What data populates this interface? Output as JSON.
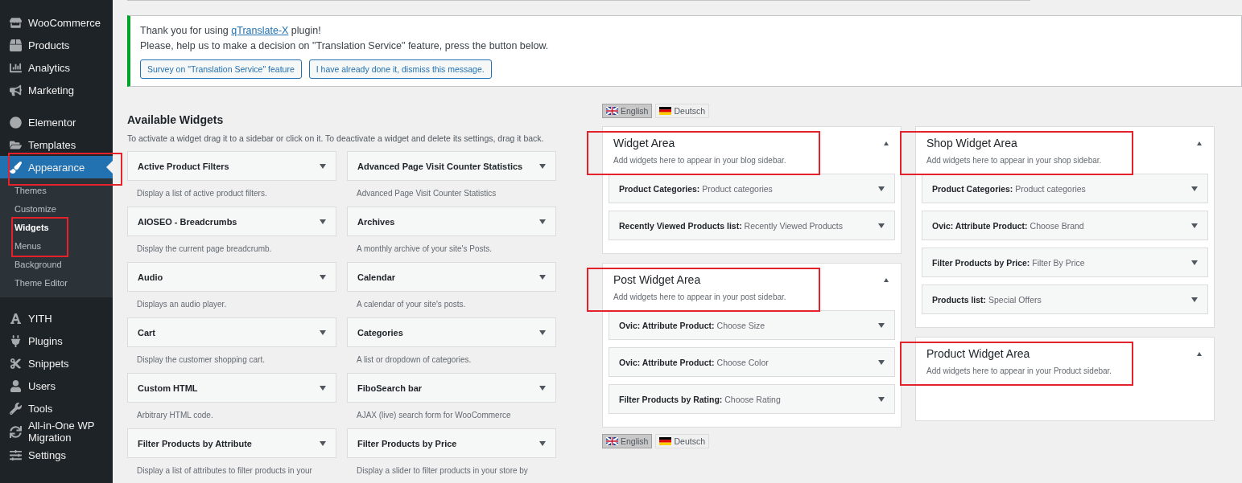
{
  "sidebar": {
    "sections": [
      {
        "items": [
          {
            "label": "WooCommerce",
            "selected": false,
            "annotated": false
          },
          {
            "label": "Products",
            "selected": false,
            "annotated": false
          },
          {
            "label": "Analytics",
            "selected": false,
            "annotated": false
          },
          {
            "label": "Marketing",
            "selected": false,
            "annotated": false
          }
        ]
      },
      {
        "items": [
          {
            "label": "Elementor",
            "selected": false,
            "annotated": false
          },
          {
            "label": "Templates",
            "selected": false,
            "annotated": false
          },
          {
            "label": "Appearance",
            "selected": true,
            "annotated": true,
            "children": [
              {
                "label": "Themes",
                "selected": false,
                "annotated": false
              },
              {
                "label": "Customize",
                "selected": false,
                "annotated": false
              },
              {
                "label": "Widgets",
                "selected": true,
                "annotated": true
              },
              {
                "label": "Menus",
                "selected": false,
                "annotated": false
              },
              {
                "label": "Background",
                "selected": false,
                "annotated": false
              },
              {
                "label": "Theme Editor",
                "selected": false,
                "annotated": false
              }
            ]
          }
        ]
      },
      {
        "items": [
          {
            "label": "YITH",
            "selected": false,
            "annotated": false
          },
          {
            "label": "Plugins",
            "selected": false,
            "annotated": false
          },
          {
            "label": "Snippets",
            "selected": false,
            "annotated": false
          },
          {
            "label": "Users",
            "selected": false,
            "annotated": false
          },
          {
            "label": "Tools",
            "selected": false,
            "annotated": false
          },
          {
            "label": "All-in-One WP Migration",
            "selected": false,
            "annotated": false
          },
          {
            "label": "Settings",
            "selected": false,
            "annotated": false
          }
        ]
      }
    ]
  },
  "notice": {
    "line_1_before": "Thank you for using",
    "link": "qTranslate-X",
    "line_1_after": "plugin!",
    "line_2": "Please, help us to make a decision on \"Translation Service\" feature, press the button below.",
    "buttons": [
      "Survey on \"Translation Service\" feature",
      "I have already done it, dismiss this message."
    ]
  },
  "available_widgets": {
    "title": "Available Widgets",
    "description": "To activate a widget drag it to a sidebar or click on it. To deactivate a widget and delete its settings, drag it back.",
    "widgets": [
      {
        "name": "Active Product Filters",
        "description": "Display a list of active product filters."
      },
      {
        "name": "Advanced Page Visit Counter Statistics",
        "description": "Advanced Page Visit Counter Statistics"
      },
      {
        "name": "AIOSEO - Breadcrumbs",
        "description": "Display the current page breadcrumb."
      },
      {
        "name": "Archives",
        "description": "A monthly archive of your site's Posts."
      },
      {
        "name": "Audio",
        "description": "Displays an audio player."
      },
      {
        "name": "Calendar",
        "description": "A calendar of your site's posts."
      },
      {
        "name": "Cart",
        "description": "Display the customer shopping cart."
      },
      {
        "name": "Categories",
        "description": "A list or dropdown of categories."
      },
      {
        "name": "Custom HTML",
        "description": "Arbitrary HTML code."
      },
      {
        "name": "FiboSearch bar",
        "description": "AJAX (live) search form for WooCommerce"
      },
      {
        "name": "Filter Products by Attribute",
        "description": "Display a list of attributes to filter products in your"
      },
      {
        "name": "Filter Products by Price",
        "description": "Display a slider to filter products in your store by"
      }
    ]
  },
  "language_switcher_top": [
    {
      "label": "English",
      "selected": true
    },
    {
      "label": "Deutsch",
      "selected": false
    }
  ],
  "language_switcher_bottom": [
    {
      "label": "English",
      "selected": true
    },
    {
      "label": "Deutsch",
      "selected": false
    }
  ],
  "widget_area_columns": [
    {
      "areas": [
        {
          "title": "Widget Area",
          "description": "Add widgets here to appear in your blog sidebar.",
          "annotated": true,
          "widgets": [
            {
              "type": "Product Categories:",
              "title": "Product categories"
            },
            {
              "type": "Recently Viewed Products list:",
              "title": "Recently Viewed Products"
            }
          ]
        },
        {
          "title": "Post Widget Area",
          "description": "Add widgets here to appear in your post sidebar.",
          "annotated": true,
          "widgets": [
            {
              "type": "Ovic: Attribute Product:",
              "title": "Choose Size"
            },
            {
              "type": "Ovic: Attribute Product:",
              "title": "Choose Color"
            },
            {
              "type": "Filter Products by Rating:",
              "title": "Choose Rating"
            }
          ]
        }
      ]
    },
    {
      "areas": [
        {
          "title": "Shop Widget Area",
          "description": "Add widgets here to appear in your shop sidebar.",
          "annotated": true,
          "widgets": [
            {
              "type": "Product Categories:",
              "title": "Product categories"
            },
            {
              "type": "Ovic: Attribute Product:",
              "title": "Choose Brand"
            },
            {
              "type": "Filter Products by Price:",
              "title": "Filter By Price"
            },
            {
              "type": "Products list:",
              "title": "Special Offers"
            }
          ]
        },
        {
          "title": "Product Widget Area",
          "description": "Add widgets here to appear in your Product sidebar.",
          "annotated": true
        }
      ]
    }
  ]
}
